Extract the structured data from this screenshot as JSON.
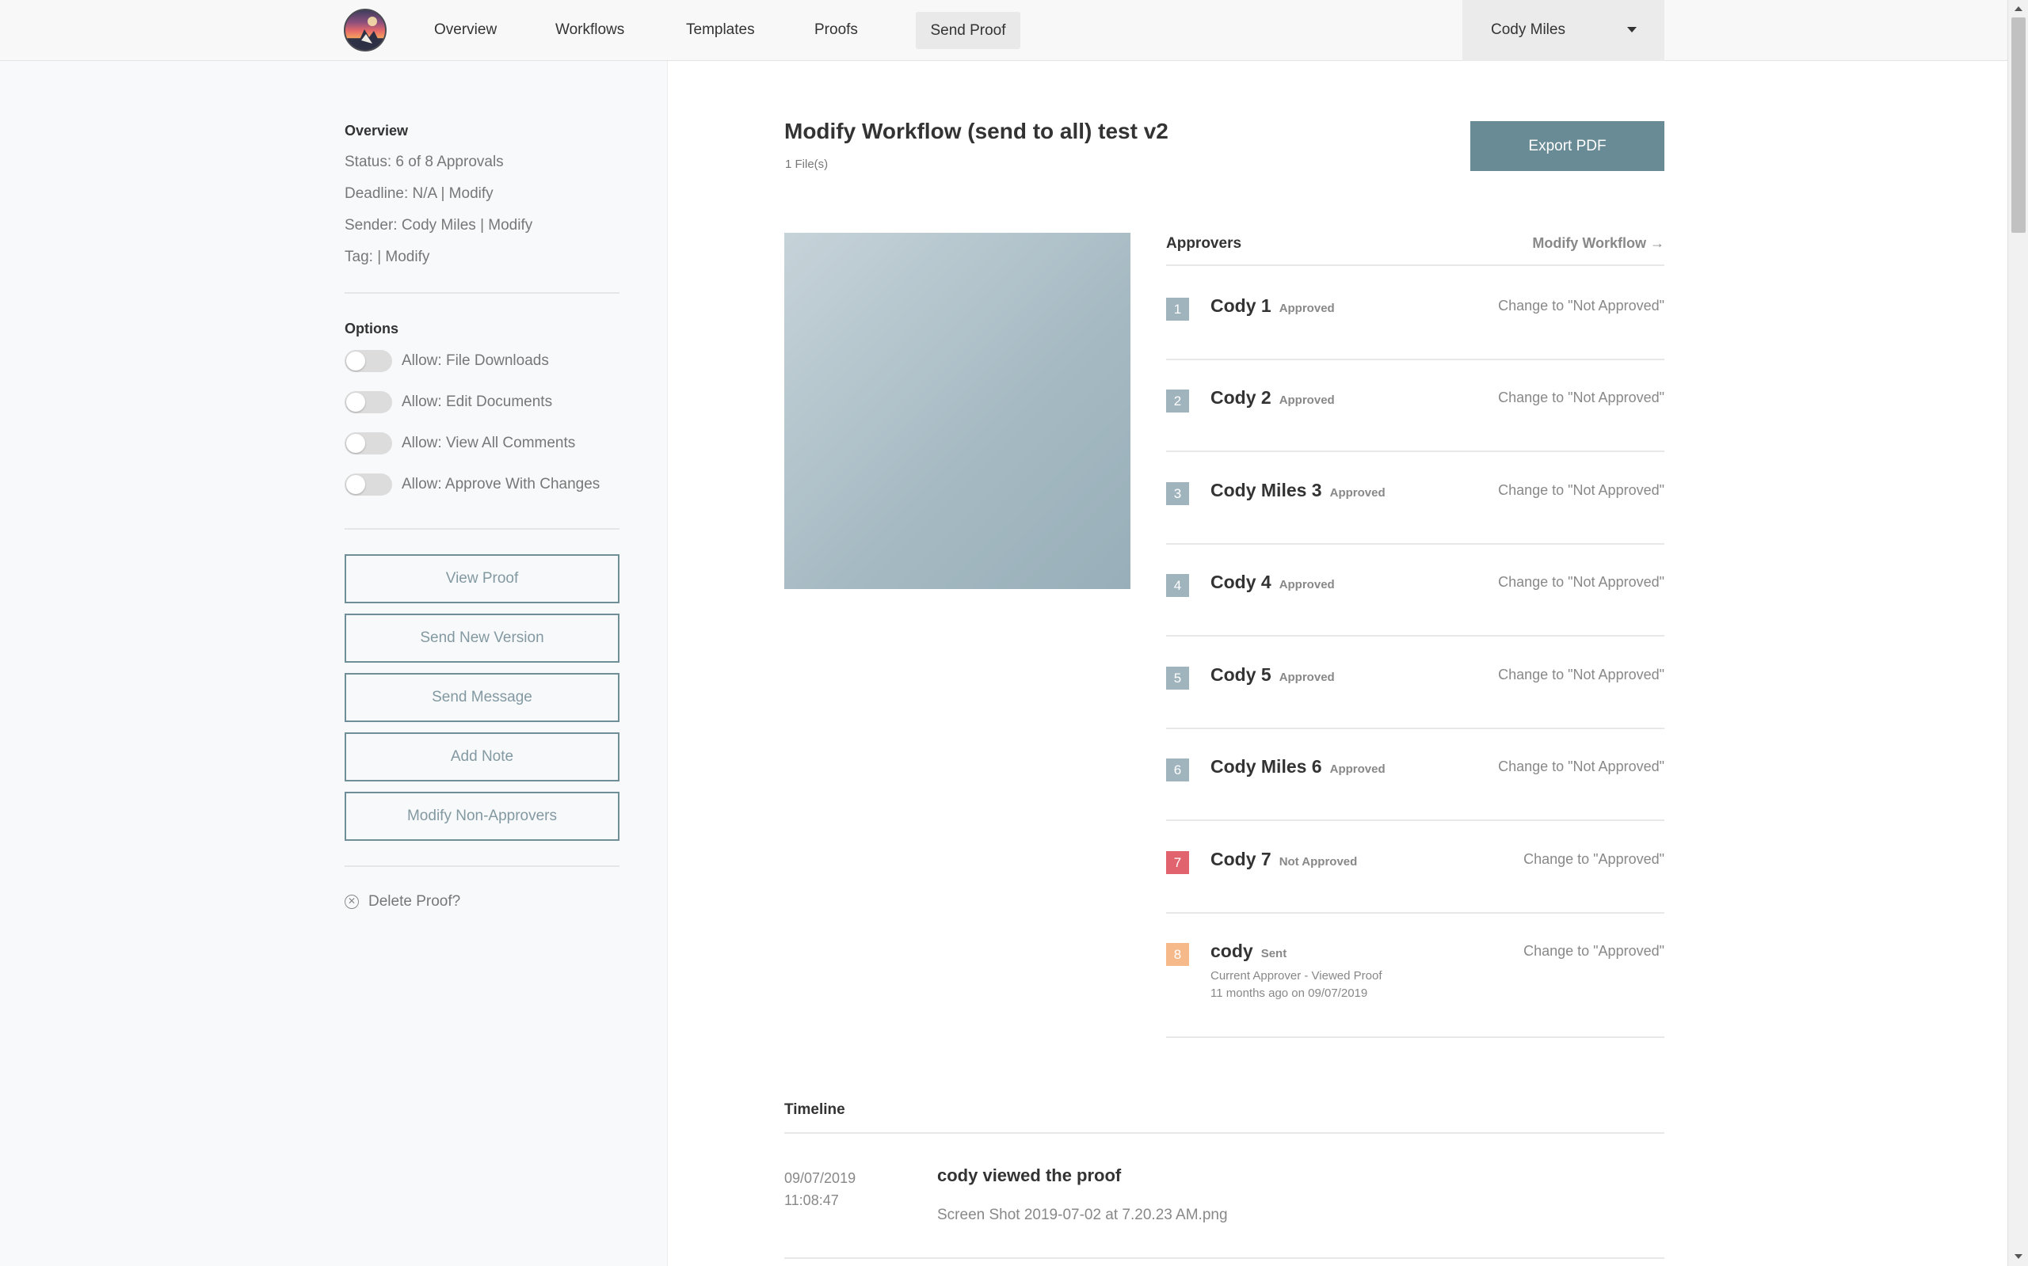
{
  "nav": {
    "items": [
      "Overview",
      "Workflows",
      "Templates",
      "Proofs"
    ],
    "active": "Send Proof",
    "user": "Cody Miles"
  },
  "sidebar": {
    "overview_heading": "Overview",
    "status": "Status: 6 of 8 Approvals",
    "deadline": "Deadline: N/A | Modify",
    "sender": "Sender: Cody Miles | Modify",
    "tag": "Tag: | Modify",
    "options_heading": "Options",
    "options": [
      "Allow: File Downloads",
      "Allow: Edit Documents",
      "Allow: View All Comments",
      "Allow: Approve With Changes"
    ],
    "buttons": [
      "View Proof",
      "Send New Version",
      "Send Message",
      "Add Note",
      "Modify Non-Approvers"
    ],
    "delete_label": "Delete Proof?"
  },
  "main": {
    "title": "Modify Workflow (send to all) test v2",
    "subtitle": "1 File(s)",
    "export_label": "Export PDF",
    "approvers_title": "Approvers",
    "modify_workflow_label": "Modify Workflow →",
    "approvers": [
      {
        "num": "1",
        "name": "Cody 1",
        "status": "Approved",
        "change": "Change to \"Not Approved\"",
        "color": "#a0b4be"
      },
      {
        "num": "2",
        "name": "Cody 2",
        "status": "Approved",
        "change": "Change to \"Not Approved\"",
        "color": "#a0b4be"
      },
      {
        "num": "3",
        "name": "Cody Miles 3",
        "status": "Approved",
        "change": "Change to \"Not Approved\"",
        "color": "#a0b4be"
      },
      {
        "num": "4",
        "name": "Cody 4",
        "status": "Approved",
        "change": "Change to \"Not Approved\"",
        "color": "#a0b4be"
      },
      {
        "num": "5",
        "name": "Cody 5",
        "status": "Approved",
        "change": "Change to \"Not Approved\"",
        "color": "#a0b4be"
      },
      {
        "num": "6",
        "name": "Cody Miles 6",
        "status": "Approved",
        "change": "Change to \"Not Approved\"",
        "color": "#a0b4be"
      },
      {
        "num": "7",
        "name": "Cody 7",
        "status": "Not Approved",
        "change": "Change to \"Approved\"",
        "color": "#e0636e"
      },
      {
        "num": "8",
        "name": "cody",
        "status": "Sent",
        "change": "Change to \"Approved\"",
        "color": "#f5b98a",
        "detail1": "Current Approver - Viewed Proof",
        "detail2": "11 months ago on 09/07/2019"
      }
    ],
    "timeline_title": "Timeline",
    "timeline": [
      {
        "date": "09/07/2019",
        "time": "11:08:47",
        "event": "cody viewed the proof",
        "file": "Screen Shot 2019-07-02 at 7.20.23 AM.png"
      }
    ]
  }
}
